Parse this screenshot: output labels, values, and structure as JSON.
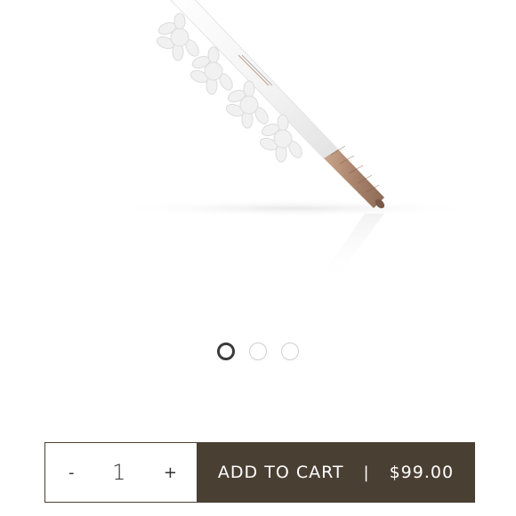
{
  "product": {
    "image_alt": "Brow pencil"
  },
  "carousel": {
    "count": 3,
    "active_index": 0
  },
  "purchase": {
    "decrement_label": "-",
    "quantity": "1",
    "increment_label": "+",
    "add_to_cart_label": "ADD TO CART",
    "separator": "|",
    "price": "$99.00"
  },
  "colors": {
    "accent": "#4a3f33",
    "dot_active": "#3b3b3b",
    "dot_inactive": "#cfcfcf"
  }
}
